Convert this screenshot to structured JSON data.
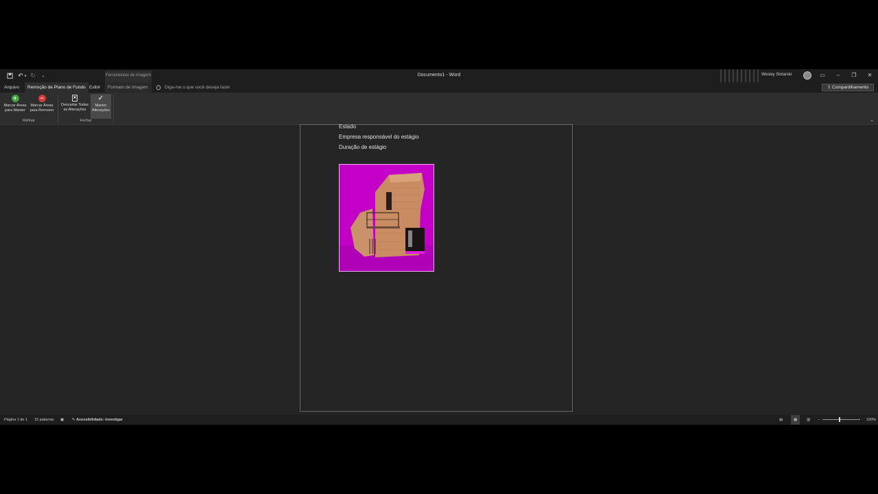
{
  "window": {
    "title": "Documento1  -  Word",
    "user_name": "Wesley Stolarski",
    "context_group": "Ferramentas de Imagem"
  },
  "quick_access": {
    "save_icon": "save-icon",
    "undo_icon": "undo-icon",
    "redo_icon": "redo-icon",
    "customize_icon": "customize-icon"
  },
  "tabs": {
    "arquivo": "Arquivo",
    "remocao": "Remoção de Plano de Fundo",
    "exibir": "Exibir",
    "formato": "Formato de Imagem",
    "tell_me": "Diga-me o que você deseja fazer",
    "share": "Compartilhamento"
  },
  "ribbon": {
    "mark_keep_1": "Marcar Áreas",
    "mark_keep_2": "para Manter",
    "mark_remove_1": "Marcar Áreas",
    "mark_remove_2": "para Remover",
    "discard_1": "Descartar Todas",
    "discard_2": "as Alterações",
    "keep_1": "Manter",
    "keep_2": "Alterações",
    "group_refinar": "Refinar",
    "group_fechar": "Fechar"
  },
  "document": {
    "lines": [
      "Estado",
      "Empresa responsável do estágio",
      "Duração de estágio"
    ]
  },
  "status": {
    "page": "Página 1 de 1",
    "words": "15 palavras",
    "accessibility": "Acessibilidade: investigar",
    "zoom": "100%"
  },
  "colors": {
    "removal_overlay": "#c400c8",
    "app_bg": "#252525"
  }
}
